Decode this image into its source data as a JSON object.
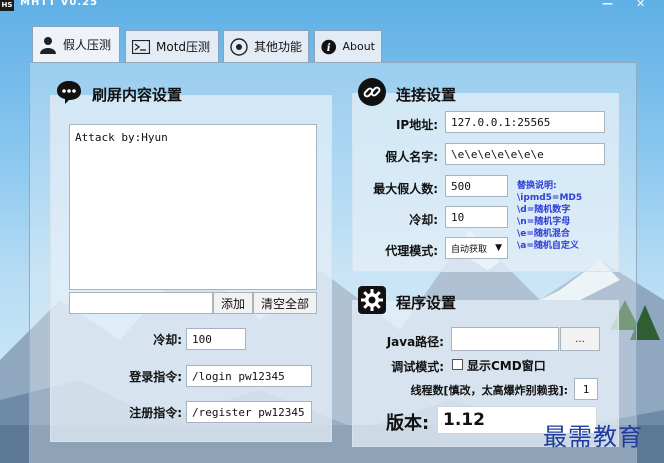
{
  "window": {
    "title": "MHTT V0.25",
    "app_icon_text": "HS"
  },
  "tabs": [
    {
      "label": "假人压测",
      "icon": "person-icon",
      "active": true
    },
    {
      "label": "Motd压测",
      "icon": "terminal-icon",
      "active": false
    },
    {
      "label": "其他功能",
      "icon": "tools-icon",
      "active": false
    },
    {
      "label": "About",
      "icon": "info-icon",
      "active": false
    }
  ],
  "spam": {
    "title": "刷屏内容设置",
    "content": "Attack by:Hyun",
    "input_value": "",
    "add_label": "添加",
    "clear_label": "清空全部",
    "cooldown_label": "冷却:",
    "cooldown_value": "100",
    "login_label": "登录指令:",
    "login_value": "/login pw12345",
    "register_label": "注册指令:",
    "register_value": "/register pw12345"
  },
  "connection": {
    "title": "连接设置",
    "ip_label": "IP地址:",
    "ip_value": "127.0.0.1:25565",
    "name_label": "假人名字:",
    "name_value": "\\e\\e\\e\\e\\e\\e\\e",
    "max_label": "最大假人数:",
    "max_value": "500",
    "cooldown_label": "冷却:",
    "cooldown_value": "10",
    "proxy_label": "代理模式:",
    "proxy_value": "自动获取",
    "notes": [
      "替换说明:",
      "\\ipmd5=MD5",
      "\\d=随机数字",
      "\\n=随机字母",
      "\\e=随机混合",
      "\\a=随机自定义"
    ]
  },
  "program": {
    "title": "程序设置",
    "java_label": "Java路径:",
    "java_value": "",
    "browse_label": "...",
    "debug_label": "调试模式:",
    "show_cmd_label": "显示CMD窗口",
    "show_cmd_checked": false,
    "threads_label": "线程数[慎改，太高爆炸别赖我]:",
    "threads_value": "1",
    "version_label": "版本:",
    "version_value": "1.12"
  },
  "watermark": "最需教育",
  "colors": {
    "note_blue": "#2e3fd6",
    "sky": "#8cc8ef"
  }
}
